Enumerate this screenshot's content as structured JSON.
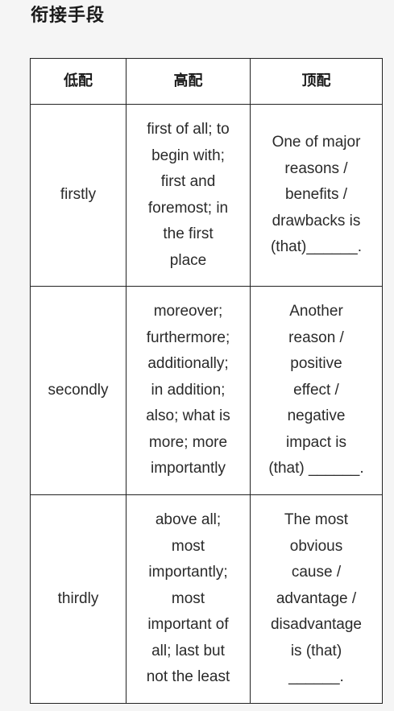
{
  "title": "衔接手段",
  "table": {
    "headers": [
      "低配",
      "高配",
      "顶配"
    ],
    "rows": [
      {
        "low": "firstly",
        "high": "first of all; to\nbegin with;\nfirst and\nforemost; in\nthe first\nplace",
        "top": "One of major\nreasons /\nbenefits /\ndrawbacks is\n(that)______."
      },
      {
        "low": "secondly",
        "high": "moreover;\nfurthermore;\nadditionally;\nin addition;\nalso; what is\nmore; more\nimportantly",
        "top": "Another\nreason /\npositive\neffect /\nnegative\nimpact is\n(that) ______."
      },
      {
        "low": "thirdly",
        "high": "above all;\nmost\nimportantly;\nmost\nimportant of\nall; last but\nnot the least",
        "top": "The most\nobvious\ncause /\nadvantage /\ndisadvantage\nis (that)\n______."
      }
    ]
  }
}
